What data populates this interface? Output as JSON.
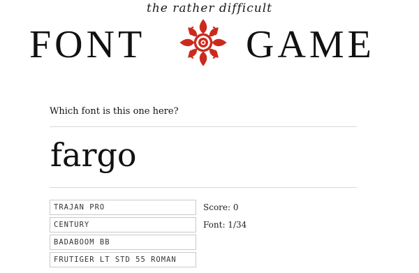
{
  "header": {
    "tagline": "the rather difficult",
    "logo_left": "FONT",
    "logo_right": "GAME",
    "emblem_icon": "ornamental-rosette-icon",
    "emblem_color": "#cc2a1e"
  },
  "game": {
    "question": "Which font is this one here?",
    "sample_word": "fargo",
    "options": [
      "TRAJAN PRO",
      "CENTURY",
      "BADABOOM BB",
      "FRUTIGER LT STD 55 ROMAN"
    ],
    "score_text": "Score: 0",
    "progress_text": "Font: 1/34"
  }
}
